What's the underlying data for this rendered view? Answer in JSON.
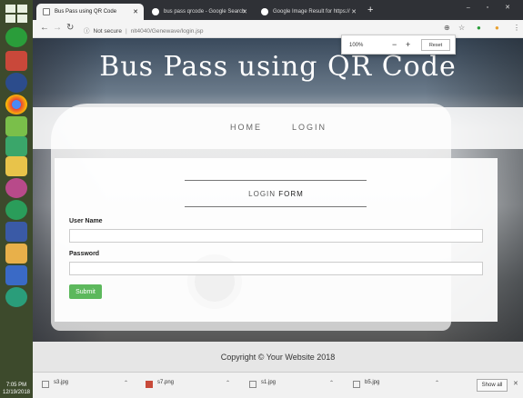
{
  "colors": {
    "submit_green": "#5cb85c",
    "tabbar": "#2f3136",
    "taskbar": "#3d4a2c"
  },
  "taskbar": {
    "clock_time": "7:05 PM",
    "clock_date": "12/19/2018"
  },
  "tabs": [
    {
      "title": "Bus Pass using QR Code",
      "icon": "document-icon"
    },
    {
      "title": "bus pass qrcode - Google Search",
      "icon": "google-icon"
    },
    {
      "title": "Google Image Result for https://",
      "icon": "google-icon"
    }
  ],
  "address": {
    "security": "Not secure",
    "url": "nlt4040/Genewave/login.jsp"
  },
  "zoom": {
    "level": "100%",
    "reset_label": "Reset"
  },
  "page": {
    "title": "Bus Pass using QR Code",
    "nav": [
      "HOME",
      "LOGIN"
    ],
    "form": {
      "title_light": "LOGIN",
      "title_bold": "FORM",
      "username_label": "User Name",
      "username_value": "",
      "password_label": "Password",
      "password_value": "",
      "submit_label": "Submit"
    },
    "footer": "Copyright © Your Website 2018"
  },
  "downloads": {
    "items": [
      {
        "name": "s3.jpg"
      },
      {
        "name": "s7.png"
      },
      {
        "name": "s1.jpg"
      },
      {
        "name": "b5.jpg"
      }
    ],
    "show_all_label": "Show all"
  }
}
